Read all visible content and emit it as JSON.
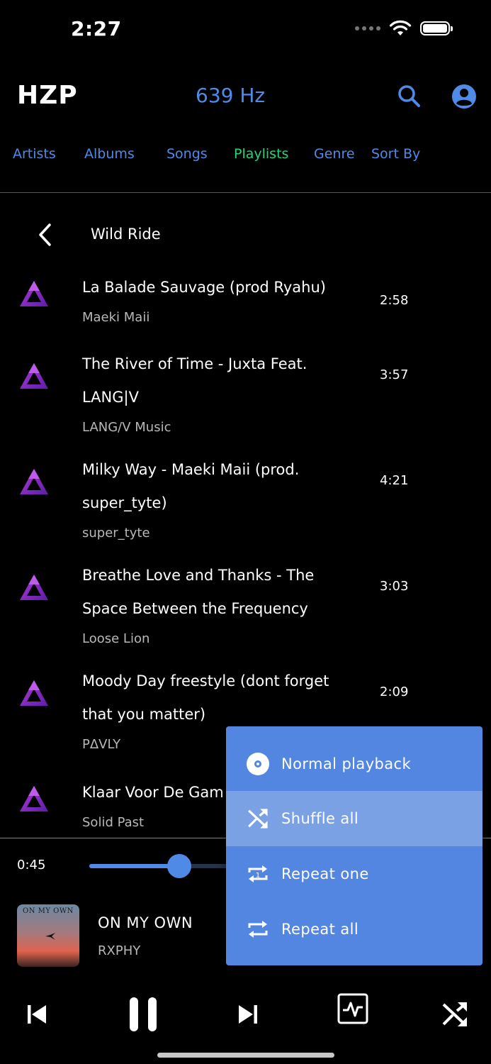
{
  "status_bar": {
    "time": "2:27"
  },
  "header": {
    "logo": "HZP",
    "frequency": "639 Hz"
  },
  "tabs": [
    {
      "label": "Artists",
      "active": false
    },
    {
      "label": "Albums",
      "active": false
    },
    {
      "label": "Songs",
      "active": false
    },
    {
      "label": "Playlists",
      "active": true
    },
    {
      "label": "Genre",
      "active": false
    },
    {
      "label": "Sort By",
      "active": false
    }
  ],
  "playlist": {
    "title": "Wild Ride",
    "songs": [
      {
        "title": "La Balade Sauvage (prod Ryahu)",
        "artist": "Maeki Maii",
        "duration": "2:58"
      },
      {
        "title": "The River of Time - Juxta Feat. LANG|V",
        "artist": "LANG/V Music",
        "duration": "3:57"
      },
      {
        "title": "Milky Way - Maeki Maii (prod. super_tyte)",
        "artist": "super_tyte",
        "duration": "4:21"
      },
      {
        "title": "Breathe Love and Thanks - The Space Between the Frequency",
        "artist": "Loose Lion",
        "duration": "3:03"
      },
      {
        "title": "Moody Day freestyle (dont forget that you matter)",
        "artist": "PΔVLY",
        "duration": "2:09"
      },
      {
        "title": "Klaar Voor De Gam",
        "artist": "Solid Past",
        "duration": ""
      }
    ]
  },
  "player": {
    "elapsed": "0:45",
    "progress": 0.265,
    "now_playing": {
      "title": "ON MY OWN",
      "artist": "RXPHY",
      "art_text": "ON MY OWN"
    }
  },
  "playback_menu": {
    "items": [
      {
        "label": "Normal playback",
        "icon": "disc-icon",
        "highlighted": false
      },
      {
        "label": "Shuffle all",
        "icon": "shuffle-icon",
        "highlighted": true
      },
      {
        "label": "Repeat one",
        "icon": "repeat-one-icon",
        "highlighted": false
      },
      {
        "label": "Repeat all",
        "icon": "repeat-all-icon",
        "highlighted": false
      }
    ]
  },
  "colors": {
    "accent": "#4f8be6",
    "active_tab": "#21d67a",
    "menu_bg": "#5386e0",
    "menu_highlight": "#7aa1e4"
  }
}
